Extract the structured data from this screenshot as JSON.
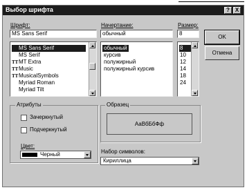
{
  "window": {
    "title": "Выбор шрифта",
    "help_btn": "?",
    "close_btn": "X"
  },
  "font": {
    "label": "Шрифт:",
    "value": "MS Sans Serif",
    "items": [
      {
        "ttf": "",
        "label": "MS Sans Serif"
      },
      {
        "ttf": "",
        "label": "MS Serif"
      },
      {
        "ttf": "TT",
        "label": "MT Extra"
      },
      {
        "ttf": "TT",
        "label": "Music"
      },
      {
        "ttf": "TT",
        "label": "MusicalSymbols"
      },
      {
        "ttf": "",
        "label": "Myriad Roman"
      },
      {
        "ttf": "",
        "label": "Myriad Tilt"
      }
    ]
  },
  "style": {
    "label": "Начертание:",
    "value": "обычный",
    "items": [
      "обычный",
      "курсив",
      "полужирный",
      "полужирный курсив"
    ]
  },
  "size": {
    "label": "Размер:",
    "value": "8",
    "items": [
      "8",
      "10",
      "12",
      "14",
      "18",
      "24"
    ]
  },
  "buttons": {
    "ok": "OK",
    "cancel": "Отмена"
  },
  "effects": {
    "group_label": "Атрибуты",
    "strikeout": "Зачеркнутый",
    "underline": "Подчеркнутый",
    "color_label": "Цвет:",
    "color_value": "Черный",
    "color_swatch": "#000000"
  },
  "sample": {
    "group_label": "Образец",
    "text": "АаВбБбФф"
  },
  "script": {
    "label": "Набор символов:",
    "value": "Кириллица"
  }
}
